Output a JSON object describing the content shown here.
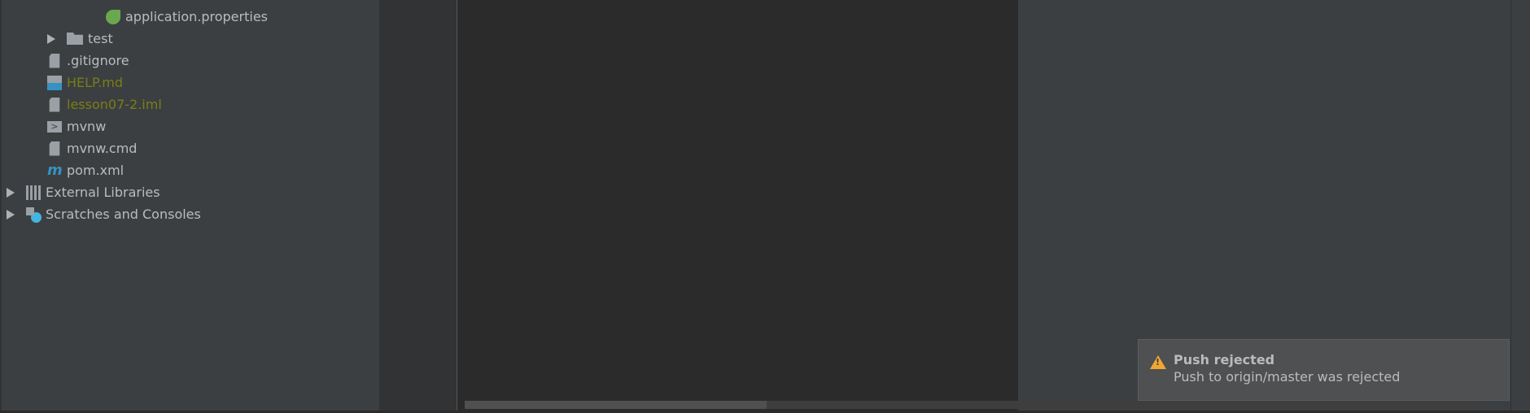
{
  "project_tree": {
    "items": [
      {
        "label": "application.properties",
        "icon": "spring-properties-icon",
        "modified": false
      },
      {
        "label": "test",
        "icon": "folder-icon",
        "modified": false
      },
      {
        "label": ".gitignore",
        "icon": "ignore-file-icon",
        "modified": false
      },
      {
        "label": "HELP.md",
        "icon": "markdown-file-icon",
        "modified": true
      },
      {
        "label": "lesson07-2.iml",
        "icon": "module-file-icon",
        "modified": true
      },
      {
        "label": "mvnw",
        "icon": "shell-script-icon",
        "modified": false
      },
      {
        "label": "mvnw.cmd",
        "icon": "text-file-icon",
        "modified": false
      },
      {
        "label": "pom.xml",
        "icon": "maven-icon",
        "modified": false
      },
      {
        "label": "External Libraries",
        "icon": "libraries-icon",
        "modified": false
      },
      {
        "label": "Scratches and Consoles",
        "icon": "scratches-icon",
        "modified": false
      }
    ]
  },
  "notification": {
    "title": "Push rejected",
    "message": "Push to origin/master was rejected",
    "icon": "warning-icon",
    "color": "#f0a732"
  }
}
